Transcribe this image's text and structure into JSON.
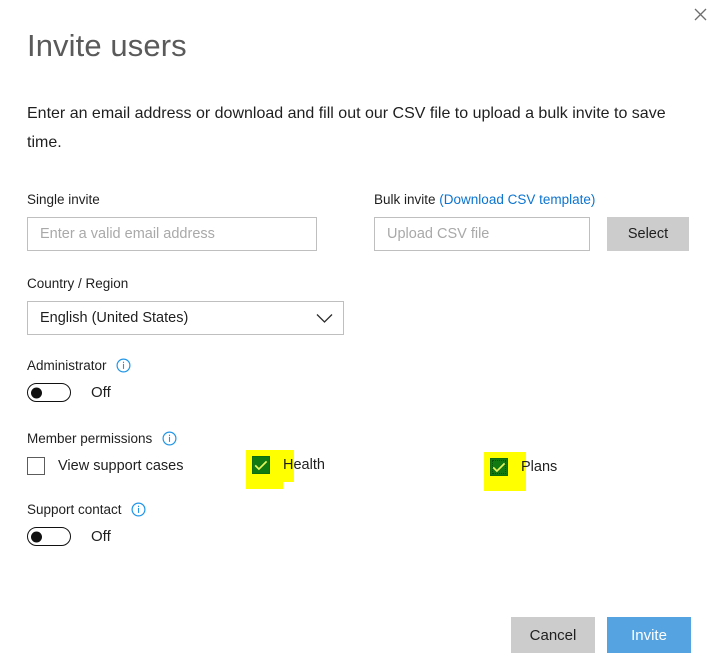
{
  "dialog": {
    "title": "Invite users",
    "intro": "Enter an email address or download and fill out our CSV file to upload a bulk invite to save time.",
    "close_icon": "close-icon"
  },
  "single_invite": {
    "label": "Single invite",
    "placeholder": "Enter a valid email address",
    "value": ""
  },
  "bulk_invite": {
    "label": "Bulk invite",
    "link_label": "(Download CSV template)",
    "placeholder": "Upload CSV file",
    "value": "",
    "select_button": "Select"
  },
  "country": {
    "label": "Country / Region",
    "selected": "English (United States)",
    "chevron_icon": "chevron-down-icon"
  },
  "administrator": {
    "label": "Administrator",
    "info_icon": "info-icon",
    "state": "Off",
    "on": false
  },
  "member_permissions": {
    "label": "Member permissions",
    "info_icon": "info-icon",
    "options": [
      {
        "label": "View support cases",
        "checked": false,
        "highlighted": false,
        "focused": false
      },
      {
        "label": "Health",
        "checked": true,
        "highlighted": true,
        "focused": false
      },
      {
        "label": "Plans",
        "checked": true,
        "highlighted": true,
        "focused": true
      }
    ]
  },
  "support_contact": {
    "label": "Support contact",
    "info_icon": "info-icon",
    "state": "Off",
    "on": false
  },
  "footer": {
    "cancel_label": "Cancel",
    "invite_label": "Invite"
  },
  "colors": {
    "link": "#0b74d0",
    "primary_button": "#55a3e0",
    "secondary_button": "#cccccc",
    "checkbox_checked": "#117a11",
    "highlight": "#ffff00",
    "title": "#5a5a5a",
    "info_icon": "#0b8ae0"
  }
}
